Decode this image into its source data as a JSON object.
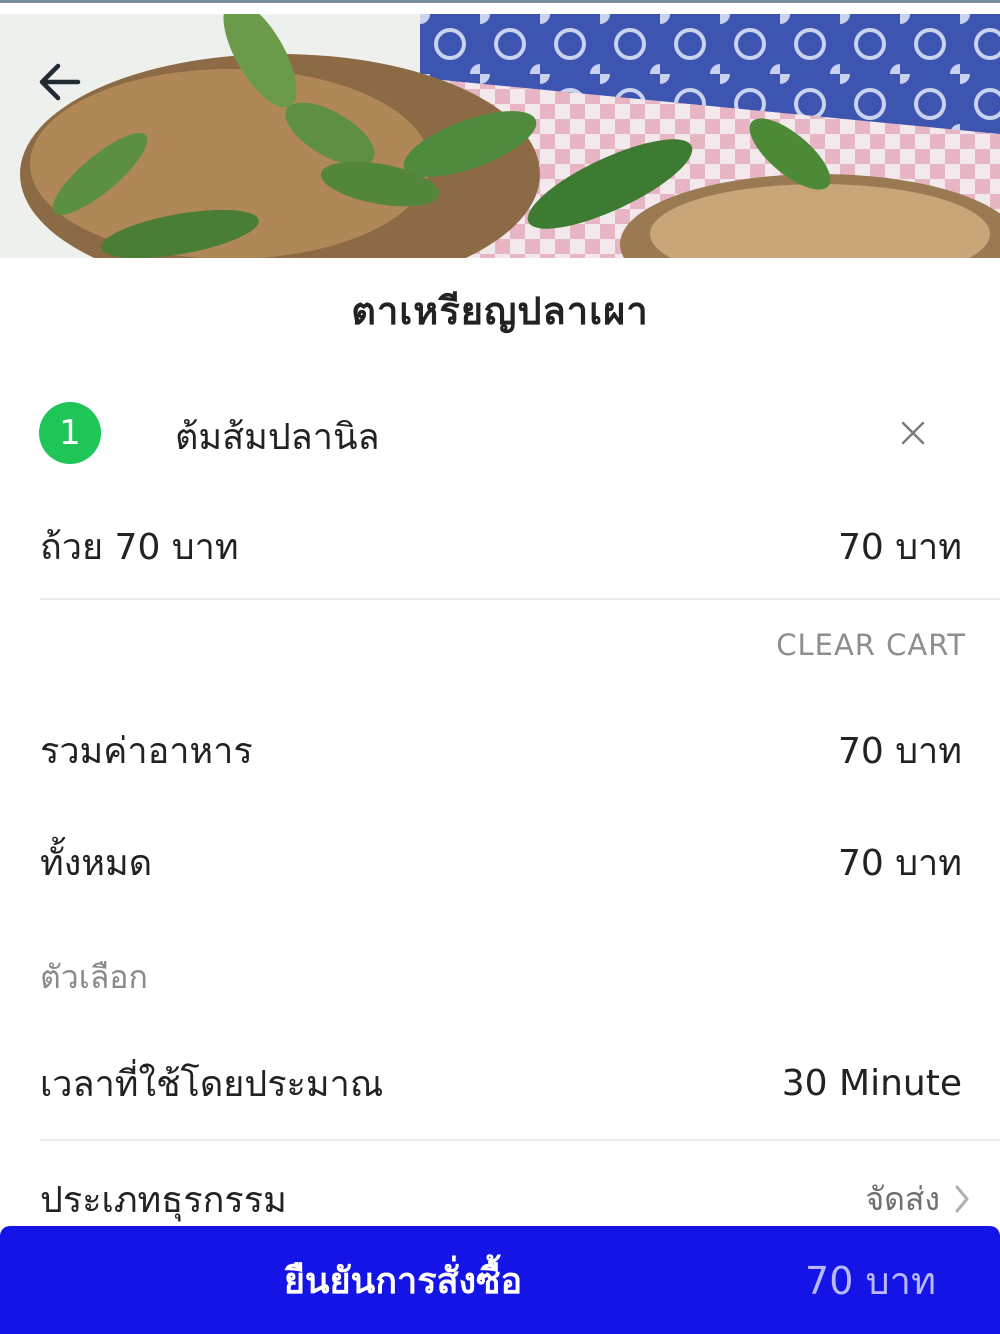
{
  "header": {
    "back_icon": "arrow-left-icon"
  },
  "store": {
    "name": "ตาเหรียญปลาเผา"
  },
  "cart_item": {
    "quantity": "1",
    "name": "ต้มส้มปลานิล",
    "remove_icon": "close-icon",
    "option_label": "ถ้วย 70 บาท",
    "price": "70 บาท"
  },
  "clear_cart_label": "CLEAR CART",
  "summary": {
    "food_total_label": "รวมค่าอาหาร",
    "food_total_value": "70 บาท",
    "grand_total_label": "ทั้งหมด",
    "grand_total_value": "70 บาท"
  },
  "options": {
    "section_label": "ตัวเลือก",
    "time_label": "เวลาที่ใช้โดยประมาณ",
    "time_value": "30 Minute",
    "type_label": "ประเภทธุรกรรม",
    "type_value": "จัดส่ง",
    "type_icon": "chevron-right-icon"
  },
  "confirm": {
    "label": "ยืนยันการสั่งซื้อ",
    "price": "70 บาท"
  },
  "colors": {
    "badge_green": "#1fc557",
    "confirm_blue": "#1414e6"
  }
}
